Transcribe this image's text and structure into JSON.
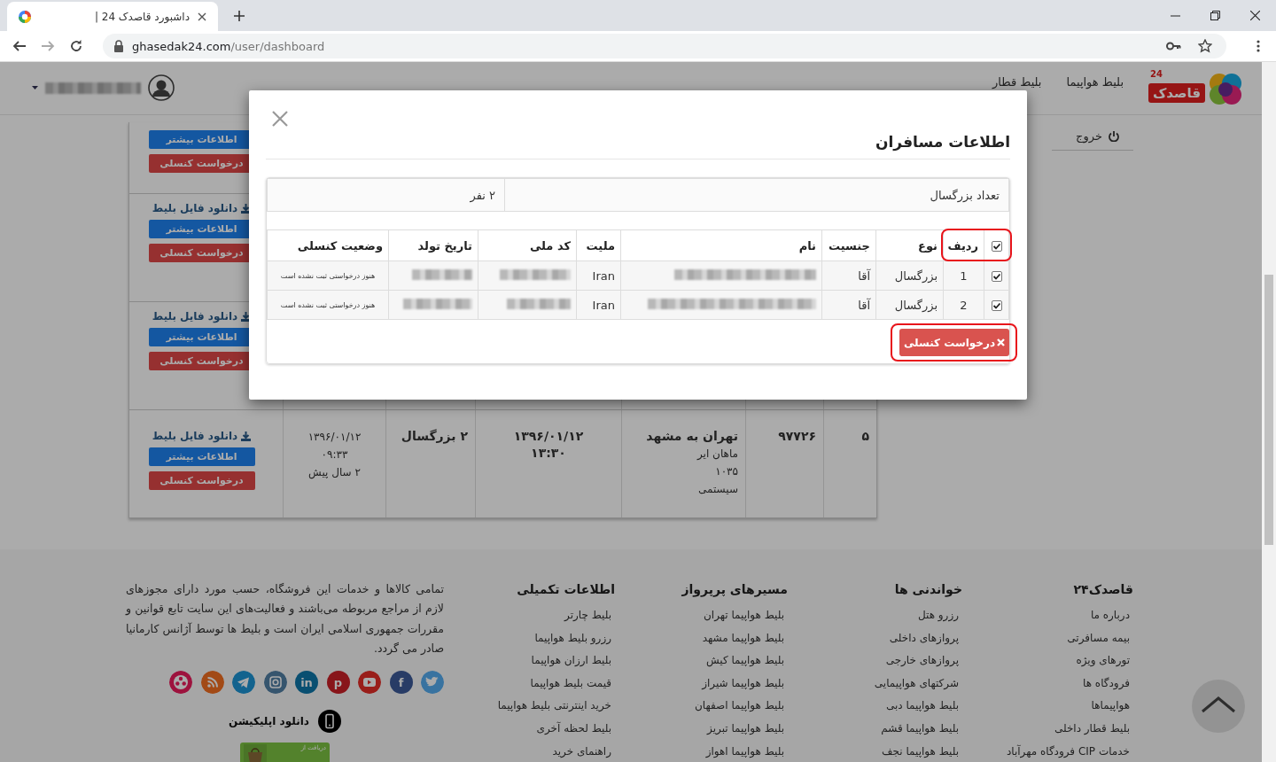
{
  "browser": {
    "tab_title": "داشبورد قاصدک 24 |",
    "url_domain": "ghasedak24.com",
    "url_path": "/user/dashboard"
  },
  "header": {
    "logo_text": "قاصدک",
    "logo_badge": "24",
    "nav": [
      {
        "label": "بلیط هواپیما"
      },
      {
        "label": "بلیط قطار"
      }
    ],
    "user_name_redacted": true
  },
  "sidebar": {
    "items": [
      {
        "label": "خروج"
      }
    ]
  },
  "orders": {
    "rows": [
      {
        "actions": [
          {
            "kind": "info",
            "label": "اطلاعات بیشتر"
          },
          {
            "kind": "cancel",
            "label": "درخواست کنسلی"
          }
        ]
      },
      {
        "actions": [
          {
            "kind": "download",
            "label": "دانلود فایل بلیط"
          },
          {
            "kind": "info",
            "label": "اطلاعات بیشتر"
          },
          {
            "kind": "cancel",
            "label": "درخواست کنسلی"
          }
        ]
      },
      {
        "actions": [
          {
            "kind": "download",
            "label": "دانلود فایل بلیط"
          },
          {
            "kind": "info",
            "label": "اطلاعات بیشتر"
          },
          {
            "kind": "cancel",
            "label": "درخواست کنسلی"
          }
        ]
      },
      {
        "cells": [
          {
            "bold": [
              "۵"
            ]
          },
          {
            "bold": [
              "۹۷۷۲۶"
            ]
          },
          {
            "bold": [
              "تهران به مشهد"
            ],
            "plain": [
              "ماهان ایر",
              "۱۰۳۵",
              "سیستمی"
            ]
          },
          {
            "bold": [
              "۱۳۹۶/۰۱/۱۲",
              "۱۳:۳۰"
            ]
          },
          {
            "bold": [
              "۲ بزرگسال"
            ]
          },
          {
            "plain": [
              "۱۳۹۶/۰۱/۱۲",
              "۰۹:۳۳",
              "۲ سال پیش"
            ]
          }
        ],
        "actions": [
          {
            "kind": "download",
            "label": "دانلود فایل بلیط"
          },
          {
            "kind": "info",
            "label": "اطلاعات بیشتر"
          },
          {
            "kind": "cancel",
            "label": "درخواست کنسلی"
          }
        ]
      }
    ]
  },
  "modal": {
    "title": "اطلاعات مسافران",
    "summary": [
      {
        "label": "تعداد بزرگسال",
        "value": "۲ نفر"
      }
    ],
    "table": {
      "select_all": true,
      "header_highlighted": true,
      "columns": [
        "ردیف",
        "نوع",
        "جنسیت",
        "نام",
        "ملیت",
        "کد ملی",
        "تاریخ تولد",
        "وضعیت کنسلی"
      ],
      "rows": [
        {
          "checked": true,
          "index": "1",
          "type": "بزرگسال",
          "gender": "آقا",
          "nationality": "Iran",
          "status": "هنوز درخواستی ثبت نشده است",
          "redacted": true
        },
        {
          "checked": true,
          "index": "2",
          "type": "بزرگسال",
          "gender": "آقا",
          "nationality": "Iran",
          "status": "هنوز درخواستی ثبت نشده است",
          "redacted": true
        }
      ]
    },
    "cancel_button": {
      "label": "درخواست کنسلی",
      "highlighted": true
    }
  },
  "footer": {
    "columns": [
      {
        "title": "قاصدک۲۴",
        "links": [
          "درباره ما",
          "بیمه مسافرتی",
          "تورهای ویژه",
          "فرودگاه ها",
          "هواپیماها",
          "بلیط قطار داخلی",
          "خدمات CIP فرودگاه مهرآباد"
        ]
      },
      {
        "title": "خواندنی ها",
        "links": [
          "رزرو هتل",
          "پروازهای داخلی",
          "پروازهای خارجی",
          "شرکتهای هواپیمایی",
          "بلیط هواپیما دبی",
          "بلیط هواپیما قشم",
          "بلیط هواپیما نجف"
        ]
      },
      {
        "title": "مسیرهای پرپرواز",
        "links": [
          "بلیط هواپیما تهران",
          "بلیط هواپیما مشهد",
          "بلیط هواپیما کیش",
          "بلیط هواپیما شیراز",
          "بلیط هواپیما اصفهان",
          "بلیط هواپیما تبریز",
          "بلیط هواپیما اهواز"
        ]
      },
      {
        "title": "اطلاعات تکمیلی",
        "links": [
          "بلیط چارتر",
          "رزرو بلیط هواپیما",
          "بلیط ارزان هواپیما",
          "قیمت بلیط هواپیما",
          "خرید اینترنتی بلیط هواپیما",
          "بلیط لحظه آخری",
          "راهنمای خرید"
        ]
      }
    ],
    "about": "تمامی کالاها و خدمات این فروشگاه، حسب مورد دارای مجوزهای لازم از مراجع مربوطه می‌باشند و فعالیت‌های این سایت تابع قوانین و مقررات جمهوری اسلامی ایران است و بلیط ها توسط آژانس کارمانیا صادر می گردد.",
    "social": [
      {
        "kind": "bird",
        "color": "#3973a0"
      },
      {
        "kind": "letter",
        "glyph": "f",
        "color": "#283c66"
      },
      {
        "kind": "play",
        "color": "#991e1a"
      },
      {
        "kind": "letter",
        "glyph": "p",
        "color": "#88151a"
      },
      {
        "kind": "letter",
        "glyph": "in",
        "color": "#094f71"
      },
      {
        "kind": "camera",
        "color": "#36556e"
      },
      {
        "kind": "plane",
        "color": "#13638e"
      },
      {
        "kind": "rss",
        "color": "#a24a16"
      },
      {
        "kind": "reel",
        "color": "#9d133e"
      }
    ],
    "app": {
      "label": "دانلود اپلیکیشن",
      "badge_text": "دریافت از"
    }
  }
}
